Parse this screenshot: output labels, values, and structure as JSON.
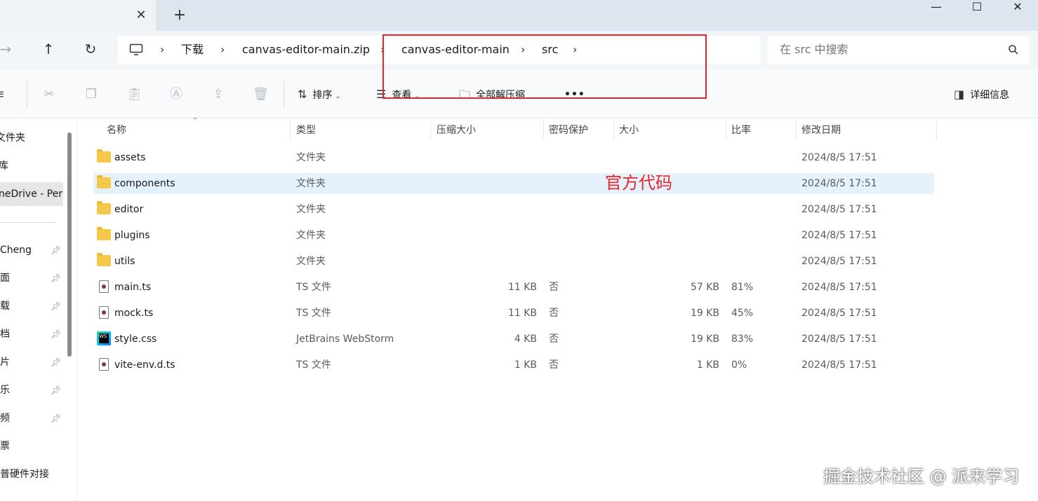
{
  "window": {
    "tab_close": "✕",
    "tab_new": "+",
    "minimize": "—",
    "maximize": "☐",
    "close": "✕"
  },
  "nav": {
    "forward": "→",
    "up": "↑",
    "refresh": "↻"
  },
  "breadcrumb": {
    "items": [
      "下载",
      "canvas-editor-main.zip",
      "canvas-editor-main",
      "src"
    ],
    "separator": "›"
  },
  "search": {
    "placeholder": "在 src 中搜索",
    "icon": "search-icon"
  },
  "toolbar": {
    "sort_label": "排序",
    "view_label": "查看",
    "extract_label": "全部解压缩",
    "more_label": "•••",
    "details_label": "详细信息"
  },
  "sidebar": {
    "items": [
      {
        "label": "文件夹",
        "pinned": false
      },
      {
        "label": "库",
        "pinned": false
      },
      {
        "label": "neDrive - Per",
        "pinned": false,
        "selected": true
      },
      {
        "label": "Cheng",
        "pinned": true
      },
      {
        "label": "面",
        "pinned": true
      },
      {
        "label": "载",
        "pinned": true
      },
      {
        "label": "档",
        "pinned": true
      },
      {
        "label": "片",
        "pinned": true
      },
      {
        "label": "乐",
        "pinned": true
      },
      {
        "label": "频",
        "pinned": true
      },
      {
        "label": "票",
        "pinned": false
      },
      {
        "label": "普硬件对接",
        "pinned": false
      }
    ]
  },
  "columns": {
    "name": "名称",
    "type": "类型",
    "compressed": "压缩大小",
    "password": "密码保护",
    "size": "大小",
    "ratio": "比率",
    "modified": "修改日期"
  },
  "files": [
    {
      "name": "assets",
      "kind": "folder",
      "type": "文件夹",
      "compressed": "",
      "password": "",
      "size": "",
      "ratio": "",
      "modified": "2024/8/5 17:51"
    },
    {
      "name": "components",
      "kind": "folder",
      "type": "文件夹",
      "compressed": "",
      "password": "",
      "size": "",
      "ratio": "",
      "modified": "2024/8/5 17:51",
      "selected": true
    },
    {
      "name": "editor",
      "kind": "folder",
      "type": "文件夹",
      "compressed": "",
      "password": "",
      "size": "",
      "ratio": "",
      "modified": "2024/8/5 17:51"
    },
    {
      "name": "plugins",
      "kind": "folder",
      "type": "文件夹",
      "compressed": "",
      "password": "",
      "size": "",
      "ratio": "",
      "modified": "2024/8/5 17:51"
    },
    {
      "name": "utils",
      "kind": "folder",
      "type": "文件夹",
      "compressed": "",
      "password": "",
      "size": "",
      "ratio": "",
      "modified": "2024/8/5 17:51"
    },
    {
      "name": "main.ts",
      "kind": "ts",
      "type": "TS 文件",
      "compressed": "11 KB",
      "password": "否",
      "size": "57 KB",
      "ratio": "81%",
      "modified": "2024/8/5 17:51"
    },
    {
      "name": "mock.ts",
      "kind": "ts",
      "type": "TS 文件",
      "compressed": "11 KB",
      "password": "否",
      "size": "19 KB",
      "ratio": "45%",
      "modified": "2024/8/5 17:51"
    },
    {
      "name": "style.css",
      "kind": "webstorm",
      "type": "JetBrains WebStorm",
      "compressed": "4 KB",
      "password": "否",
      "size": "19 KB",
      "ratio": "83%",
      "modified": "2024/8/5 17:51"
    },
    {
      "name": "vite-env.d.ts",
      "kind": "ts",
      "type": "TS 文件",
      "compressed": "1 KB",
      "password": "否",
      "size": "1 KB",
      "ratio": "0%",
      "modified": "2024/8/5 17:51"
    }
  ],
  "annotation": {
    "text": "官方代码",
    "color": "#e8262a"
  },
  "watermark": "掘金技术社区 @ 派来学习"
}
